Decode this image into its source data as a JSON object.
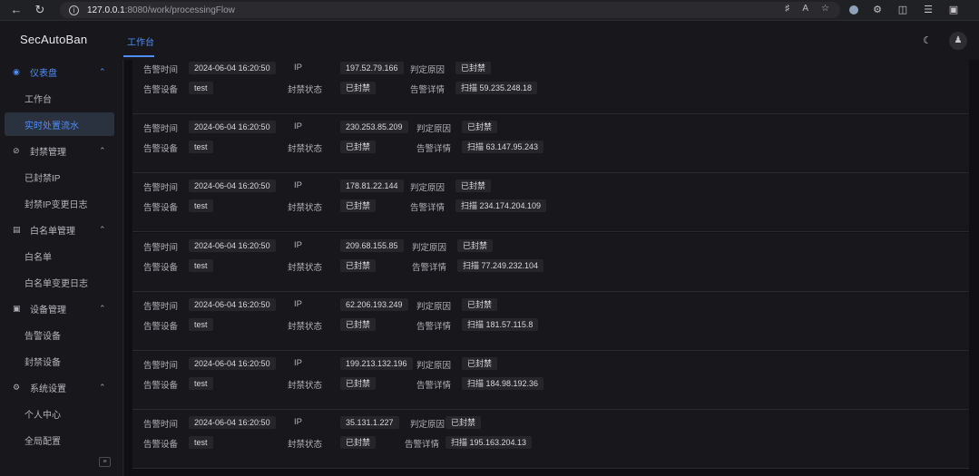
{
  "browser": {
    "url_host": "127.0.0.1",
    "url_rest": ":8080/work/processingFlow"
  },
  "app": {
    "logo": "SecAutoBan",
    "top_tab": "工作台"
  },
  "sidebar": {
    "groups": [
      {
        "label": "仪表盘",
        "icon": "dashboard-icon",
        "items": [
          "工作台",
          "实时处置流水"
        ]
      },
      {
        "label": "封禁管理",
        "icon": "ban-icon",
        "items": [
          "已封禁IP",
          "封禁IP变更日志"
        ]
      },
      {
        "label": "白名单管理",
        "icon": "whitelist-icon",
        "items": [
          "白名单",
          "白名单变更日志"
        ]
      },
      {
        "label": "设备管理",
        "icon": "device-icon",
        "items": [
          "告警设备",
          "封禁设备"
        ]
      },
      {
        "label": "系统设置",
        "icon": "settings-icon",
        "items": [
          "个人中心",
          "全局配置"
        ]
      }
    ],
    "selected": "实时处置流水"
  },
  "labels": {
    "alert_time": "告警时间",
    "ip": "IP",
    "reason": "判定原因",
    "alert_device": "告警设备",
    "ban_status": "封禁状态",
    "alert_detail": "告警详情"
  },
  "records": [
    {
      "time": "2024-06-04 16:20:50",
      "ip": "197.52.79.166",
      "reason": "已封禁",
      "device": "test",
      "status": "已封禁",
      "detail": "扫描 59.235.248.18"
    },
    {
      "time": "2024-06-04 16:20:50",
      "ip": "230.253.85.209",
      "reason": "已封禁",
      "device": "test",
      "status": "已封禁",
      "detail": "扫描 63.147.95.243"
    },
    {
      "time": "2024-06-04 16:20:50",
      "ip": "178.81.22.144",
      "reason": "已封禁",
      "device": "test",
      "status": "已封禁",
      "detail": "扫描 234.174.204.109"
    },
    {
      "time": "2024-06-04 16:20:50",
      "ip": "209.68.155.85",
      "reason": "已封禁",
      "device": "test",
      "status": "已封禁",
      "detail": "扫描 77.249.232.104"
    },
    {
      "time": "2024-06-04 16:20:50",
      "ip": "62.206.193.249",
      "reason": "已封禁",
      "device": "test",
      "status": "已封禁",
      "detail": "扫描 181.57.115.8"
    },
    {
      "time": "2024-06-04 16:20:50",
      "ip": "199.213.132.196",
      "reason": "已封禁",
      "device": "test",
      "status": "已封禁",
      "detail": "扫描 184.98.192.36"
    },
    {
      "time": "2024-06-04 16:20:50",
      "ip": "35.131.1.227",
      "reason": "已封禁",
      "device": "test",
      "status": "已封禁",
      "detail": "扫描 195.163.204.13"
    }
  ]
}
